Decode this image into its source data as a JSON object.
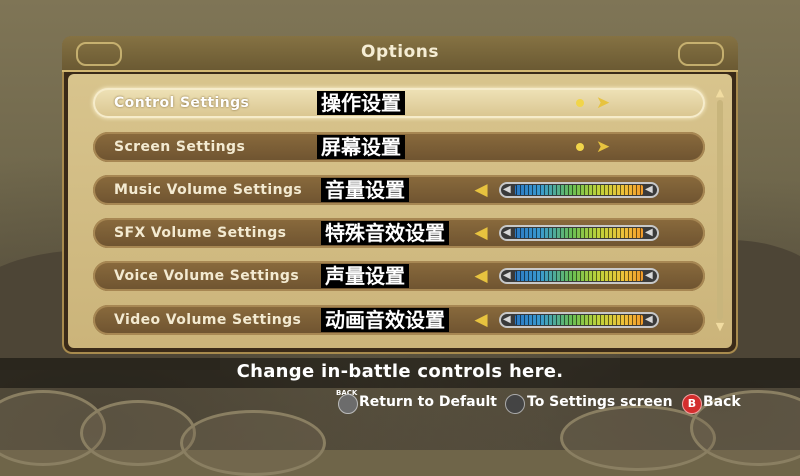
{
  "header": {
    "title": "Options"
  },
  "settings": [
    {
      "label": "Control Settings",
      "cn": "操作设置",
      "type": "submenu"
    },
    {
      "label": "Screen Settings",
      "cn": "屏幕设置",
      "type": "submenu"
    },
    {
      "label": "Music Volume Settings",
      "cn": "音量设置",
      "type": "slider",
      "level": 1.0
    },
    {
      "label": "SFX Volume Settings",
      "cn": "特殊音效设置",
      "type": "slider",
      "level": 1.0
    },
    {
      "label": "Voice Volume Settings",
      "cn": "声量设置",
      "type": "slider",
      "level": 1.0
    },
    {
      "label": "Video Volume Settings",
      "cn": "动画音效设置",
      "type": "slider",
      "level": 1.0
    }
  ],
  "description": "Change in-battle controls here.",
  "footer": {
    "back_small": "BACK",
    "return_default": "Return to Default",
    "to_settings": "To Settings screen",
    "b_button": "B",
    "back": "Back"
  },
  "colors": {
    "accent": "#e7c33f",
    "selected_row": "#efe3b8",
    "row": "#7a5f36",
    "b_button": "#d32d2d"
  }
}
